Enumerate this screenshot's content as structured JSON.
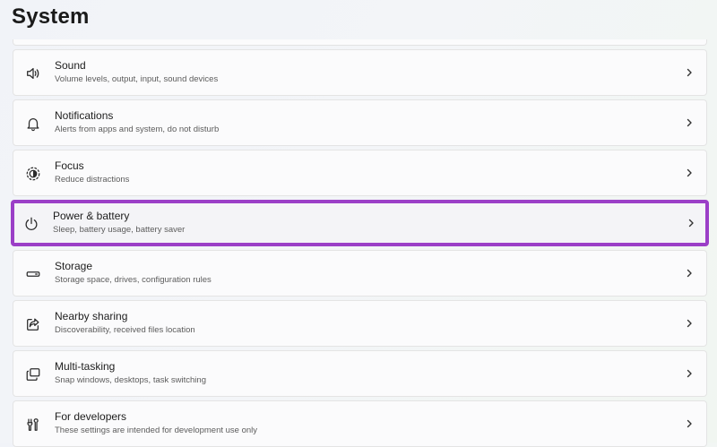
{
  "page": {
    "title": "System"
  },
  "colors": {
    "highlight_border": "#9b3fc7"
  },
  "items": [
    {
      "label": "Sound",
      "description": "Volume levels, output, input, sound devices",
      "icon": "speaker-icon"
    },
    {
      "label": "Notifications",
      "description": "Alerts from apps and system, do not disturb",
      "icon": "bell-icon"
    },
    {
      "label": "Focus",
      "description": "Reduce distractions",
      "icon": "focus-icon"
    },
    {
      "label": "Power & battery",
      "description": "Sleep, battery usage, battery saver",
      "icon": "power-icon",
      "highlighted": true
    },
    {
      "label": "Storage",
      "description": "Storage space, drives, configuration rules",
      "icon": "drive-icon"
    },
    {
      "label": "Nearby sharing",
      "description": "Discoverability, received files location",
      "icon": "share-icon"
    },
    {
      "label": "Multi-tasking",
      "description": "Snap windows, desktops, task switching",
      "icon": "multitask-icon"
    },
    {
      "label": "For developers",
      "description": "These settings are intended for development use only",
      "icon": "developer-tools-icon"
    }
  ]
}
